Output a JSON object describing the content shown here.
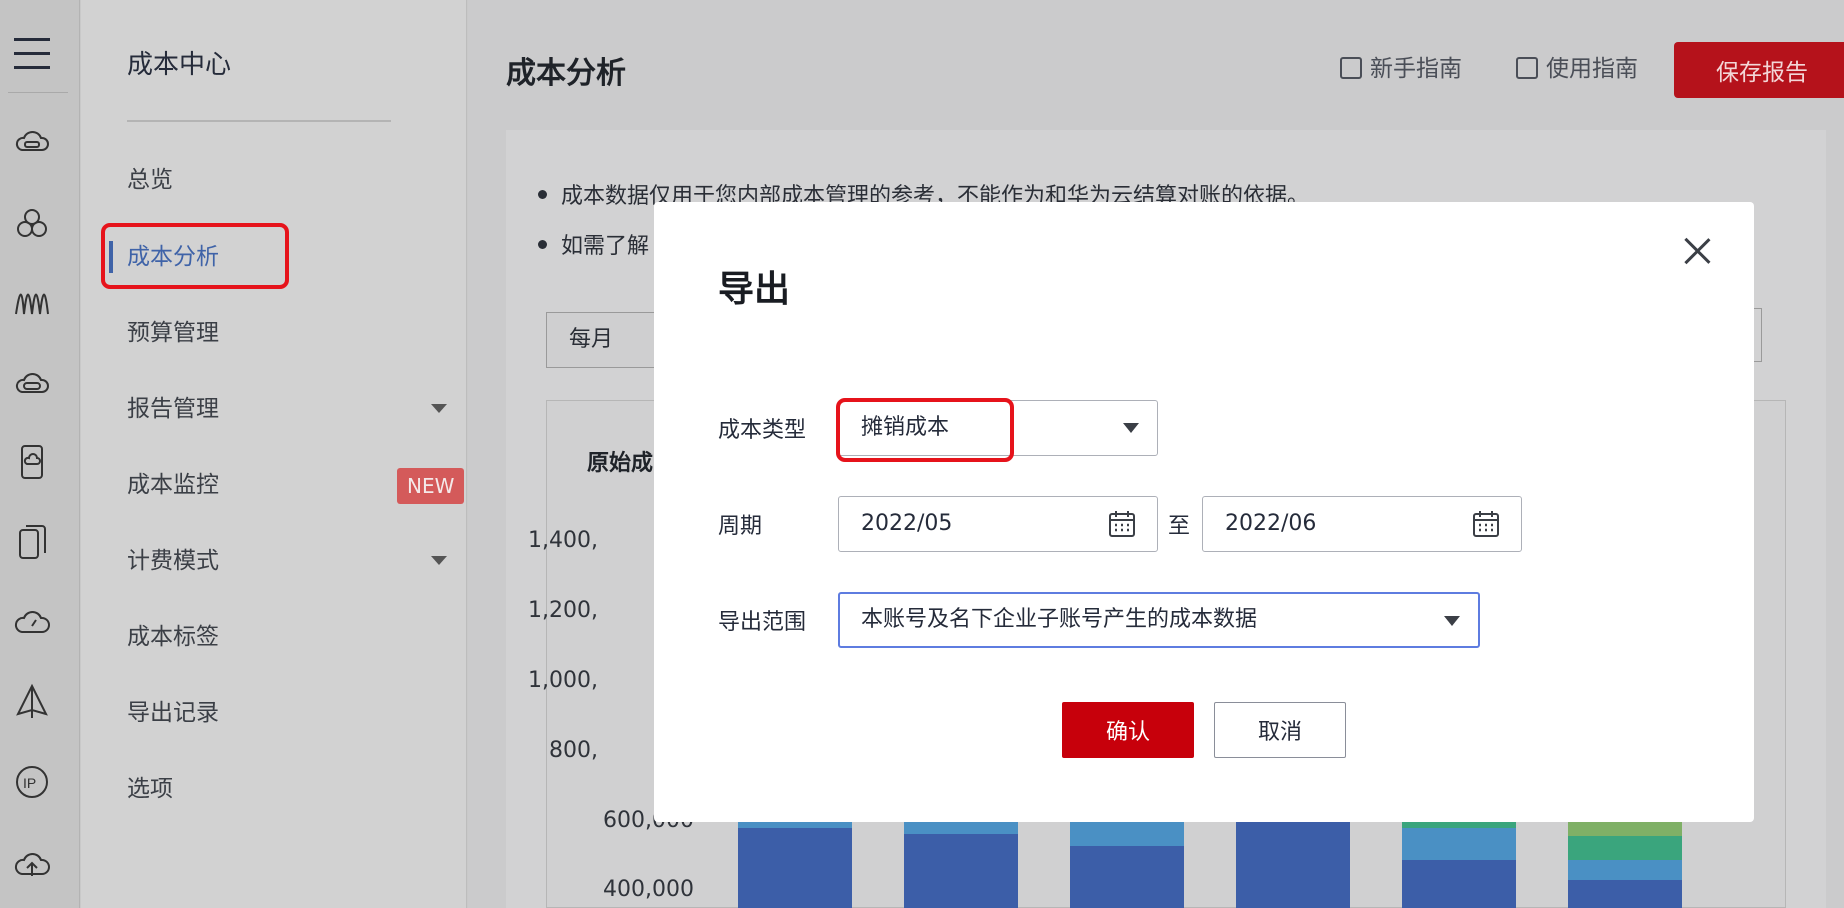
{
  "sidebar": {
    "title": "成本中心",
    "items": [
      {
        "label": "总览"
      },
      {
        "label": "成本分析"
      },
      {
        "label": "预算管理"
      },
      {
        "label": "报告管理"
      },
      {
        "label": "成本监控",
        "badge": "NEW"
      },
      {
        "label": "计费模式"
      },
      {
        "label": "成本标签"
      },
      {
        "label": "导出记录"
      },
      {
        "label": "选项"
      }
    ],
    "rail_icons": [
      "menu-icon",
      "cloud-server-icon",
      "cluster-icon",
      "waveform-icon",
      "network-icon",
      "mobile-icon",
      "multi-device-icon",
      "cloud-monitor-icon",
      "sail-icon",
      "ip-icon",
      "cloud-upload-icon"
    ]
  },
  "header": {
    "title": "成本分析",
    "guide_new": "新手指南",
    "guide_use": "使用指南",
    "save_report": "保存报告"
  },
  "notices": [
    "成本数据仅用于您内部成本管理的参考，不能作为和华为云结算对账的依据。",
    "如需了解"
  ],
  "filters": {
    "granularity": "每月"
  },
  "chart": {
    "title_partial": "原始成",
    "y_ticks": [
      "1,400,",
      "1,200,",
      "1,000,",
      "800,",
      "600,000",
      "400,000"
    ]
  },
  "chart_data": {
    "type": "bar",
    "title": "原始成",
    "stacked": true,
    "categories": [
      "",
      "",
      "",
      "",
      "",
      ""
    ],
    "ylim": [
      400000,
      1400000
    ],
    "colors": {
      "base": "#3c5ea8",
      "mid": "#4a90c4",
      "teal": "#3aa57d",
      "olive": "#7fb066"
    }
  },
  "dialog": {
    "title": "导出",
    "cost_type_label": "成本类型",
    "cost_type_value": "摊销成本",
    "period_label": "周期",
    "period_start": "2022/05",
    "period_to": "至",
    "period_end": "2022/06",
    "scope_label": "导出范围",
    "scope_value": "本账号及名下企业子账号产生的成本数据",
    "confirm": "确认",
    "cancel": "取消"
  }
}
